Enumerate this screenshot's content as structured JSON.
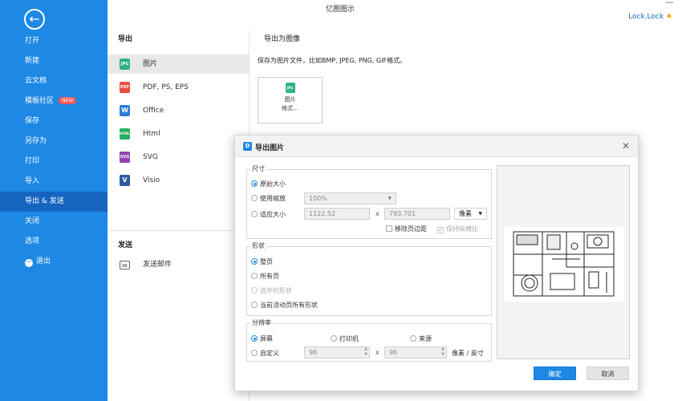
{
  "app": {
    "title": "亿图图示"
  },
  "window": {
    "min_symbol": "—",
    "user_name": "Lock.Lock"
  },
  "sidebar": {
    "items": [
      {
        "label": "打开"
      },
      {
        "label": "新建"
      },
      {
        "label": "云文档"
      },
      {
        "label": "模板社区",
        "badge": "NEW"
      },
      {
        "label": "保存"
      },
      {
        "label": "另存为"
      },
      {
        "label": "打印"
      },
      {
        "label": "导入"
      },
      {
        "label": "导出 & 发送",
        "active": true
      },
      {
        "label": "关闭"
      },
      {
        "label": "选项"
      },
      {
        "label": "退出"
      }
    ]
  },
  "export_panel": {
    "heading": "导出",
    "items": [
      {
        "label": "图片",
        "icon": "jpg-icon",
        "tag": "JPG",
        "color": "#2db37e"
      },
      {
        "label": "PDF, PS, EPS",
        "icon": "pdf-icon",
        "tag": "PDF",
        "color": "#e74c3c"
      },
      {
        "label": "Office",
        "icon": "word-icon",
        "tag": "W",
        "color": "#2b7cd3"
      },
      {
        "label": "Html",
        "icon": "html-icon",
        "tag": "HTML",
        "color": "#27ae60"
      },
      {
        "label": "SVG",
        "icon": "svg-icon",
        "tag": "SVG",
        "color": "#8e44ad"
      },
      {
        "label": "Visio",
        "icon": "visio-icon",
        "tag": "V",
        "color": "#2c5aa0"
      }
    ],
    "send_heading": "发送",
    "send_items": [
      {
        "label": "发送邮件",
        "icon": "mail-send-icon"
      }
    ]
  },
  "image_panel": {
    "heading": "导出为图像",
    "note": "保存为图片文件，比如BMP, JPEG, PNG, GIF格式。",
    "tile_tag": "JPG",
    "tile_label_1": "图片",
    "tile_label_2": "格式..."
  },
  "dialog": {
    "title": "导出图片",
    "size": {
      "label": "尺寸",
      "original": "原始大小",
      "use_zoom": "使用缩放",
      "zoom_value": "100%",
      "fit": "适应大小",
      "width": "1122.52",
      "times": "x",
      "height": "793.701",
      "unit": "像素",
      "remove_margin": "移除页边距",
      "keep_ratio": "保持纵横比"
    },
    "shape": {
      "label": "形状",
      "whole_page": "整页",
      "all_pages": "所有页",
      "selected_shapes": "选中的形状",
      "current_page_all": "当前活动页所有形状"
    },
    "resolution": {
      "label": "分辨率",
      "screen": "屏幕",
      "printer": "打印机",
      "source": "来源",
      "custom": "自定义",
      "dpi_x": "96",
      "times": "x",
      "dpi_y": "96",
      "unit": "像素 / 英寸"
    },
    "ok": "确定",
    "cancel": "取消"
  },
  "colors": {
    "accent": "#1e88e5",
    "sidebar_active": "#1565c0",
    "badge": "#ff5a5a"
  }
}
